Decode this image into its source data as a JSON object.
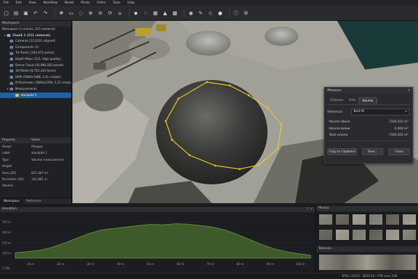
{
  "menu": [
    "File",
    "Edit",
    "View",
    "Workflow",
    "Model",
    "Photo",
    "Ortho",
    "Tools",
    "Help"
  ],
  "toolbar_icons": [
    "new-icon",
    "open-icon",
    "save-icon",
    "undo-icon",
    "redo-icon",
    "navigation-icon",
    "rectangle-selection-icon",
    "lasso-icon",
    "zoom-in-icon",
    "zoom-out-icon",
    "rotate-icon",
    "reset-view-icon",
    "model-view-icon",
    "point-cloud-icon",
    "tiled-model-icon",
    "dem-icon",
    "ortho-icon",
    "camera-icon",
    "ruler-icon",
    "shape-icon",
    "marker-icon",
    "info-icon",
    "settings-icon"
  ],
  "workspace": {
    "header": "Workspace",
    "root": "Workspace (1 chunks, 211 cameras)",
    "chunk": "Chunk 1 (211 cameras)",
    "items": [
      "Cameras (211/211 aligned)",
      "Components (1)",
      "Tie Points (343,474 points)",
      "Depth Maps (211, High quality)",
      "Dense Cloud (36,986,183 points)",
      "3D Model (8,752,164 faces)",
      "DEM (5840x7488, 3.41 cm/pix)",
      "Orthomosaic (3840x2768, 1.21 cm/pix)",
      "Measurements"
    ],
    "selected": "stockpile 1"
  },
  "properties": {
    "col_property": "Property",
    "col_value": "Value",
    "rows": [
      {
        "k": "Shape",
        "v": "Polygon"
      },
      {
        "k": "Label",
        "v": "stockpile 1"
      },
      {
        "k": "Type",
        "v": "Volume measurement"
      },
      {
        "k": "Height",
        "v": ""
      },
      {
        "k": "Area (2D)",
        "v": "822.487 m²"
      },
      {
        "k": "Perimeter (2D)",
        "v": "102.681 m"
      },
      {
        "k": "Volume",
        "v": "-"
      }
    ]
  },
  "left_tabs": {
    "workspace": "Workspace",
    "reference": "Reference"
  },
  "measure": {
    "title": "Measure",
    "tabs": [
      "Distance",
      "Area",
      "Volume"
    ],
    "active_tab": "Volume",
    "reference_label": "Reference",
    "reference_value": "Best fit",
    "volume_above_label": "Volume above",
    "volume_above": "7326.422 m³",
    "volume_below_label": "Volume below",
    "volume_below": "0.000 m³",
    "total_volume_label": "Total volume",
    "total_volume": "7326.422 m³",
    "copy_button": "Copy to Clipboard",
    "save_button": "Save...",
    "close_button": "Close"
  },
  "elevation": {
    "header": "Elevation",
    "y_ticks": [
      "145 m",
      "140 m",
      "135 m",
      "130 m"
    ],
    "x_ticks": [
      "10 m",
      "20 m",
      "30 m",
      "40 m",
      "50 m",
      "60 m",
      "70 m",
      "80 m",
      "90 m",
      "100 m"
    ],
    "scale": "1:10x",
    "fill_color": "#3e5a2a",
    "line_color": "#6f9a3c"
  },
  "photos": {
    "header": "Photos"
  },
  "textures": {
    "header": "Textures"
  },
  "status": "EPSG::32633 · 8826.94 / UTM zone 33N",
  "colors": {
    "selection": "#1f5fa8",
    "polygon": "#e7c928",
    "panel": "#202124"
  }
}
